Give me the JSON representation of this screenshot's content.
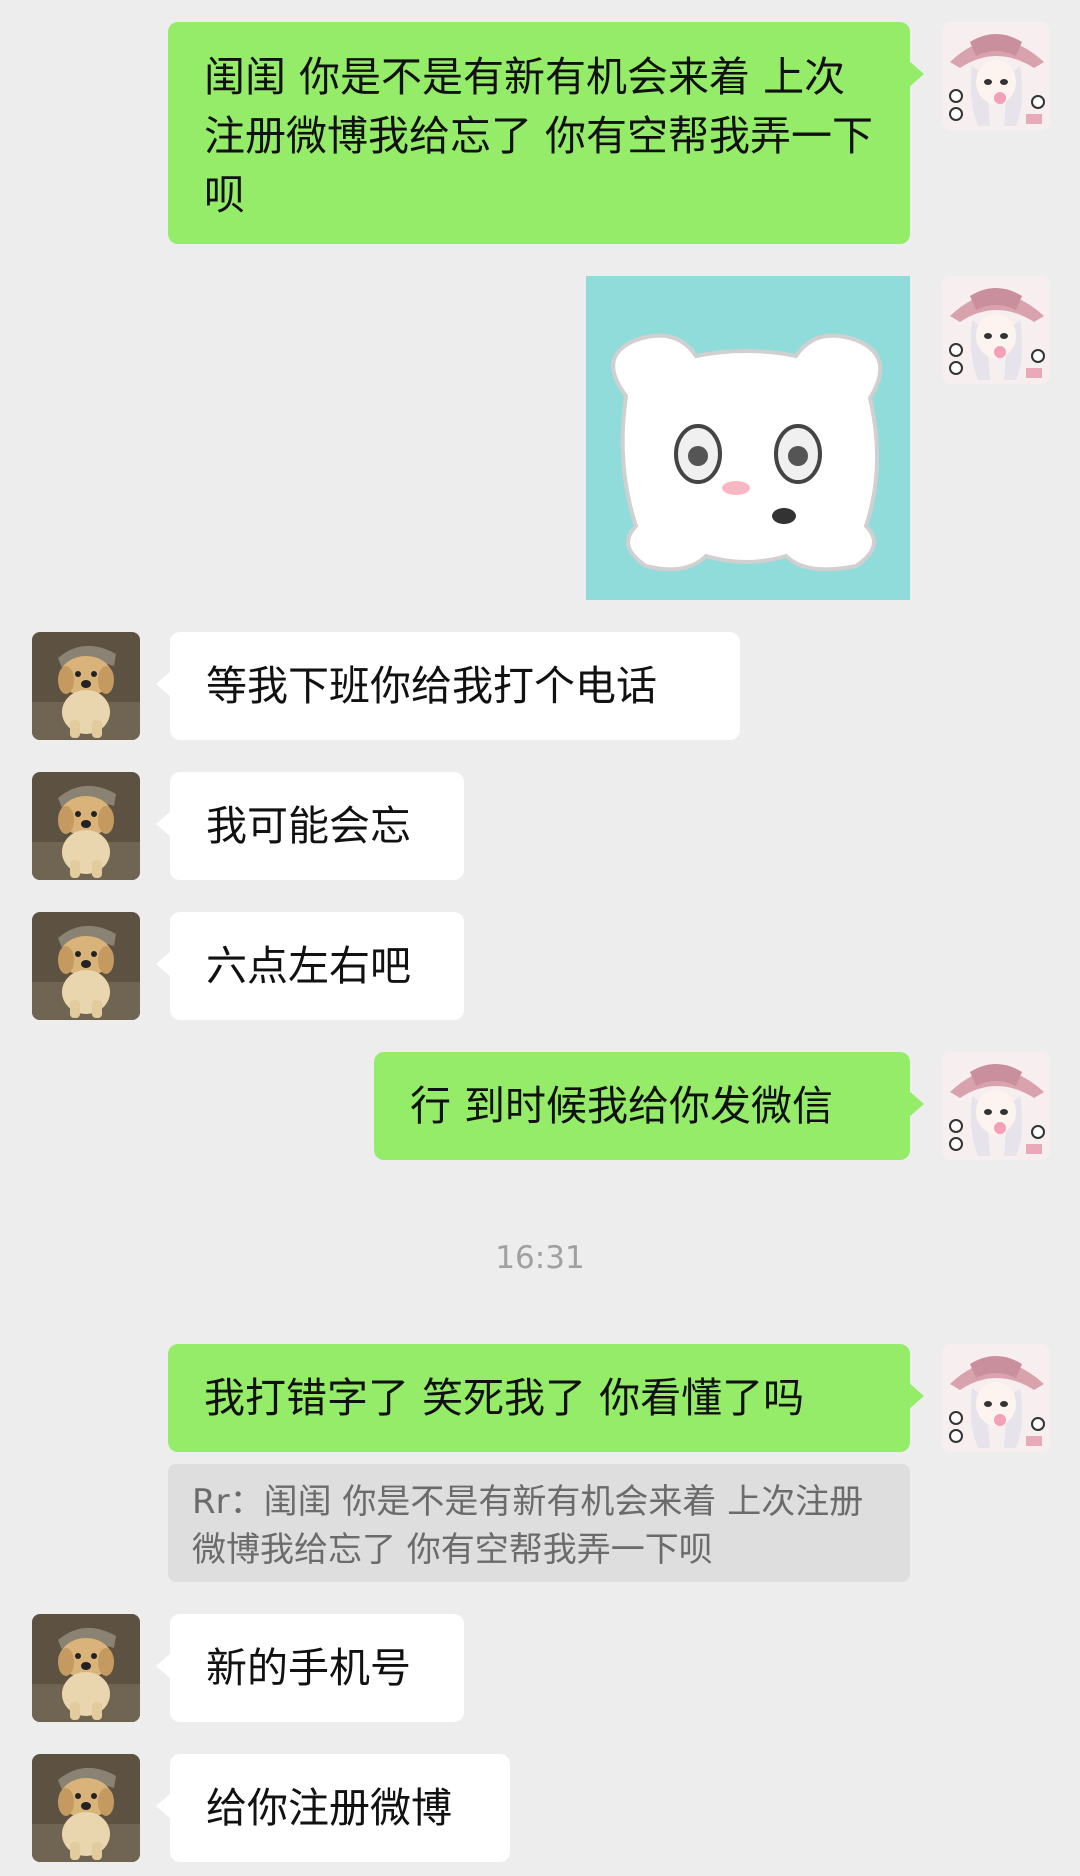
{
  "colors": {
    "background": "#ededed",
    "my_bubble": "#95ec69",
    "their_bubble": "#ffffff",
    "quote_bg": "#dedede",
    "sticker_bg": "#8fdcda"
  },
  "messages": [
    {
      "from": "me",
      "text": "闺闺 你是不是有新有机会来着 上次注册微博我给忘了 你有空帮我弄一下呗"
    },
    {
      "from": "me",
      "type": "sticker",
      "sticker_icon": "white-puppy-sticker"
    },
    {
      "from": "them",
      "text": "等我下班你给我打个电话"
    },
    {
      "from": "them",
      "text": "我可能会忘"
    },
    {
      "from": "them",
      "text": "六点左右吧"
    },
    {
      "from": "me",
      "text": "行 到时候我给你发微信"
    },
    {
      "from": "me",
      "text": "我打错字了 笑死我了 你看懂了吗"
    },
    {
      "from": "them",
      "text": "新的手机号"
    },
    {
      "from": "them",
      "text": "给你注册微博"
    }
  ],
  "timestamp": "16:31",
  "quote": {
    "text": "Rr：闺闺 你是不是有新有机会来着 上次注册微博我给忘了 你有空帮我弄一下呗"
  },
  "avatars": {
    "me": "anime-girl-avatar",
    "them": "golden-retriever-puppy-avatar"
  }
}
